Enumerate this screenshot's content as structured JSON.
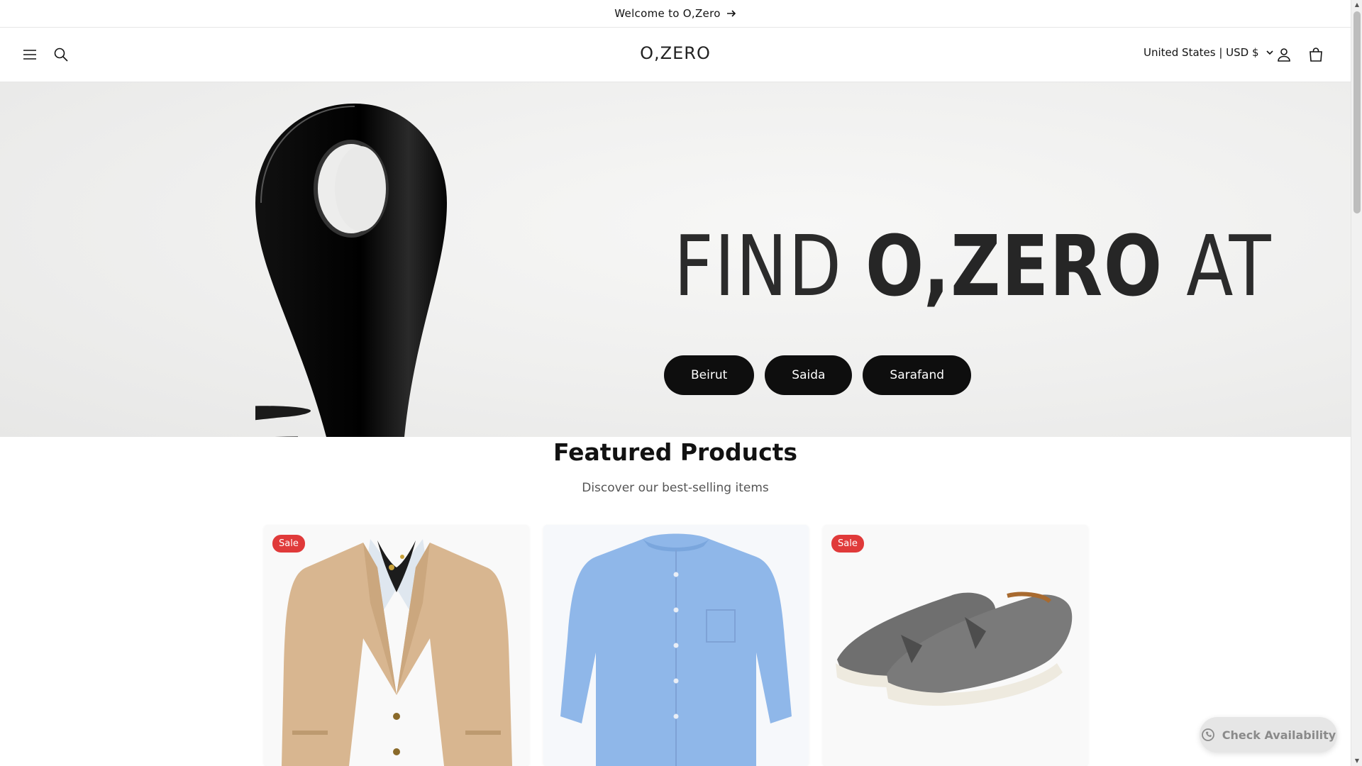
{
  "announcement": {
    "text": "Welcome to O,Zero"
  },
  "header": {
    "logo": "O,ZERO",
    "country_selector": "United States | USD $"
  },
  "hero": {
    "heading_light": "FIND ",
    "heading_bold": "O,ZERO",
    "heading_end": " AT",
    "locations": [
      "Beirut",
      "Saida",
      "Sarafand"
    ]
  },
  "featured": {
    "title": "Featured Products",
    "subtitle": "Discover our best-selling items",
    "products": [
      {
        "badge": "Sale",
        "image": "beige-blazer"
      },
      {
        "badge": "",
        "image": "blue-linen-shirt"
      },
      {
        "badge": "Sale",
        "image": "grey-suede-loafers"
      }
    ]
  },
  "floating": {
    "check_availability": "Check Availability"
  },
  "colors": {
    "button_dark": "#0e0e0e",
    "sale_badge": "#e03a3a"
  }
}
